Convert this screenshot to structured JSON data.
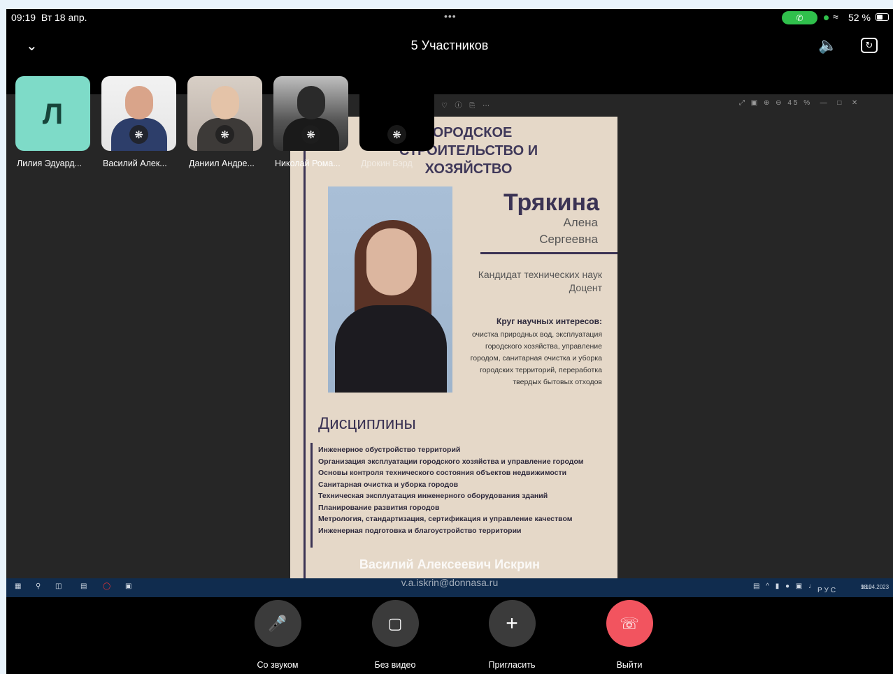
{
  "status_bar": {
    "time": "09:19",
    "date": "Вт 18 апр.",
    "dots": "•••",
    "battery_pct": "52 %",
    "call_icon": "phone-icon"
  },
  "header": {
    "title": "5 Участников",
    "collapse_icon": "chevron-down-icon",
    "speaker_icon": "speaker-icon",
    "switch_camera_icon": "camera-switch-icon"
  },
  "participants": [
    {
      "initial": "Л",
      "name": "Лилия Эдуард..."
    },
    {
      "name": "Василий Алек..."
    },
    {
      "name": "Даниил Андре..."
    },
    {
      "name": "Николай Рома..."
    },
    {
      "name": "Дрокин Бэрд"
    }
  ],
  "document": {
    "heading": "ГОРОДСКОЕ СТРОИТЕЛЬСТВО И ХОЗЯЙСТВО",
    "surname": "Трякина",
    "first_name": "Алена",
    "patronymic": "Сергеевна",
    "degree": "Кандидат технических наук",
    "position": "Доцент",
    "interests_title": "Круг научных интересов:",
    "interests": "очистка природных вод, эксплуатация городского хозяйства, управление городом, санитарная очистка и уборка городских территорий, переработка твердых бытовых отходов",
    "disciplines_title": "Дисциплины",
    "disciplines": [
      "Инженерное обустройство территорий",
      "Организация эксплуатации городского хозяйства и управление городом",
      "Основы контроля технического состояния объектов недвижимости",
      "Санитарная очистка и уборка городов",
      "Техническая эксплуатация инженерного оборудования зданий",
      "Планирование развития городов",
      "Метрология, стандартизация, сертификация и управление качеством",
      "Инженерная подготовка и благоустройство территории"
    ]
  },
  "viewer": {
    "zoom": "45 %"
  },
  "presenter": {
    "name": "Василий Алексеевич Искрин",
    "email": "v.a.iskrin@donnasa.ru"
  },
  "taskbar": {
    "lang": "РУС",
    "clock_time": "9:19",
    "clock_date": "18.04.2023"
  },
  "controls": {
    "audio": "Со звуком",
    "video": "Без видео",
    "invite": "Пригласить",
    "leave": "Выйти"
  }
}
